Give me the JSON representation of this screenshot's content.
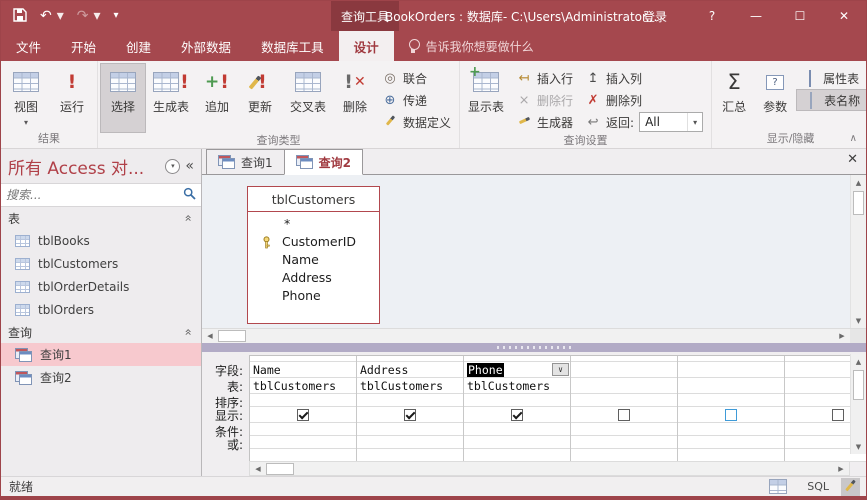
{
  "titlebar": {
    "contextual_tab_group": "查询工具",
    "title": "BookOrders : 数据库- C:\\Users\\Administrator...",
    "sign_in": "登录",
    "help": "?"
  },
  "tabs": {
    "file": "文件",
    "home": "开始",
    "create": "创建",
    "external_data": "外部数据",
    "database_tools": "数据库工具",
    "design": "设计",
    "tell_me": "告诉我你想要做什么"
  },
  "ribbon": {
    "results_group": "结果",
    "view": "视图",
    "run": "运行",
    "query_type_group": "查询类型",
    "select": "选择",
    "make_table": "生成表",
    "append": "追加",
    "update": "更新",
    "crosstab": "交叉表",
    "delete": "删除",
    "union": "联合",
    "pass_through": "传递",
    "data_definition": "数据定义",
    "query_setup_group": "查询设置",
    "show_table": "显示表",
    "insert_rows": "插入行",
    "delete_rows": "删除行",
    "builder": "生成器",
    "insert_columns": "插入列",
    "delete_columns": "删除列",
    "return_label": "返回:",
    "return_value": "All",
    "show_hide_group": "显示/隐藏",
    "totals": "汇总",
    "parameters": "参数",
    "property_sheet": "属性表",
    "table_names": "表名称"
  },
  "nav": {
    "header": "所有 Access 对...",
    "search_placeholder": "搜索...",
    "tables_section": "表",
    "tables": [
      {
        "label": "tblBooks"
      },
      {
        "label": "tblCustomers"
      },
      {
        "label": "tblOrderDetails"
      },
      {
        "label": "tblOrders"
      }
    ],
    "queries_section": "查询",
    "queries": [
      {
        "label": "查询1",
        "selected": true
      },
      {
        "label": "查询2",
        "selected": false
      }
    ]
  },
  "doc": {
    "tab1": "查询1",
    "tab2": "查询2"
  },
  "design": {
    "table_title": "tblCustomers",
    "primary_key": "CustomerID",
    "fields": {
      "all": "*",
      "f1": "CustomerID",
      "f2": "Name",
      "f3": "Address",
      "f4": "Phone"
    }
  },
  "grid": {
    "labels": {
      "field": "字段:",
      "table": "表:",
      "sort": "排序:",
      "show": "显示:",
      "criteria": "条件:",
      "or": "或:"
    },
    "columns": [
      {
        "field": "Name",
        "table": "tblCustomers",
        "show": true
      },
      {
        "field": "Address",
        "table": "tblCustomers",
        "show": true
      },
      {
        "field": "Phone",
        "table": "tblCustomers",
        "show": true,
        "selected": true
      },
      {
        "field": "",
        "table": "",
        "show": false
      },
      {
        "field": "",
        "table": "",
        "show": false
      },
      {
        "field": "",
        "table": "",
        "show": false
      }
    ]
  },
  "statusbar": {
    "ready": "就绪",
    "sql": "SQL"
  },
  "glyphs": {
    "left": "◀",
    "right": "▶",
    "up": "▲",
    "down": "▼",
    "chevron_down": "∨",
    "chevron_up": "∧",
    "shutter": "«",
    "dropdown": "▾",
    "minimize": "—",
    "maximize": "☐",
    "close": "✕",
    "undo": "↶",
    "redo": "↷",
    "insert_rows": "↤",
    "delete_rows": "⨯",
    "insert_columns": "↥",
    "delete_columns": "✗",
    "return": "↩",
    "union": "◎",
    "pass_through": "⊕"
  },
  "colors": {
    "titlebar": "#a5484e",
    "contextual": "#8a393f",
    "accent_red": "#b0343c",
    "selection_pink": "#f7c9ce",
    "table_border": "#b2484e",
    "splitter": "#b2abc6"
  }
}
